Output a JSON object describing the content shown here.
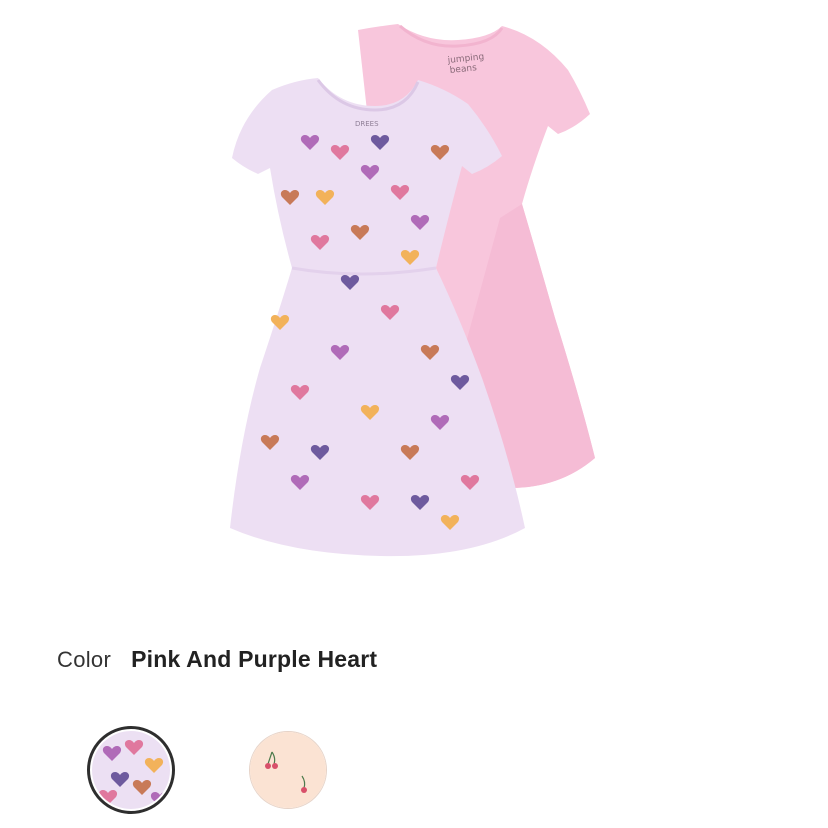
{
  "product": {
    "image_alt": "Two dresses: lavender heart-print dress and solid pink dress",
    "garment_tag_front": "DREES",
    "garment_tag_back": "jumping beans"
  },
  "color_selector": {
    "label": "Color",
    "selected_value": "Pink And Purple Heart",
    "swatches": [
      {
        "name": "Pink And Purple Heart",
        "selected": true,
        "color": "#ece0f3"
      },
      {
        "name": "Cherry",
        "selected": false,
        "color": "#fbe3d3"
      }
    ]
  },
  "colors": {
    "text": "#333333",
    "selected_ring": "#2e2e2e",
    "dress_lavender": "#efe2f4",
    "dress_pink": "#f9c9dd"
  }
}
